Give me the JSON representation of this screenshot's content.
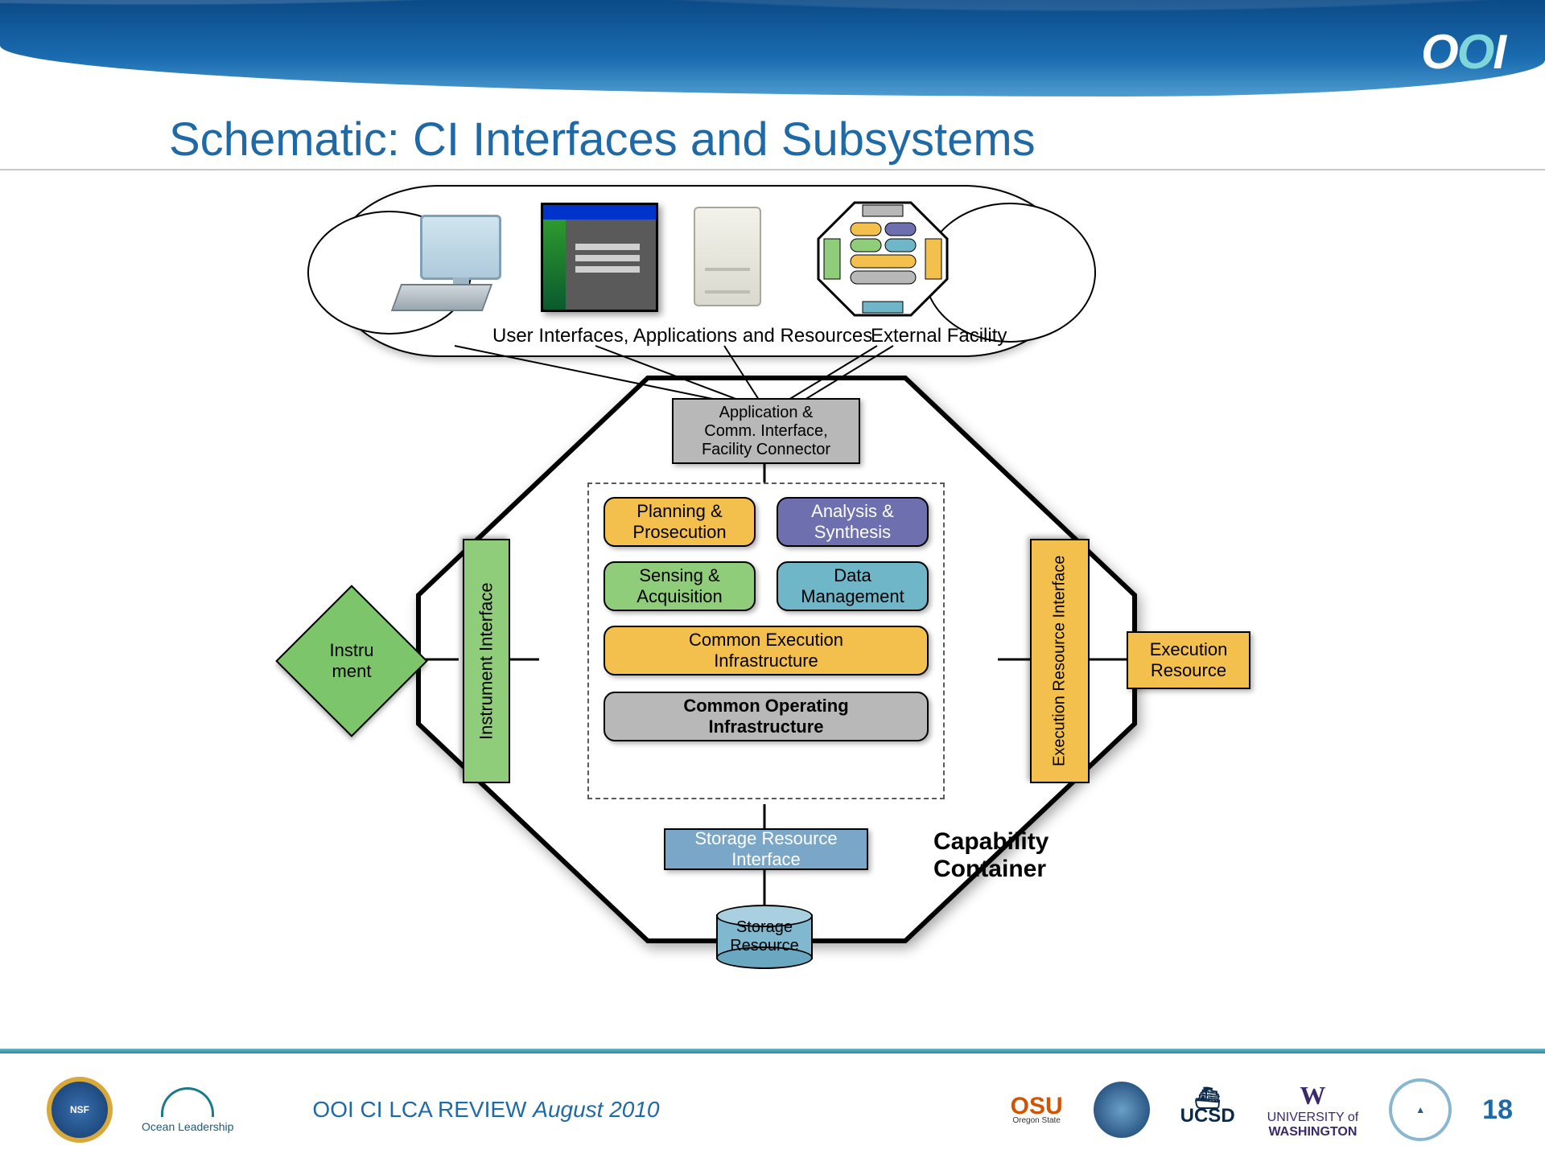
{
  "header": {
    "logo": "OOI"
  },
  "title": "Schematic: CI Interfaces and Subsystems",
  "cloud": {
    "caption_left": "User Interfaces, Applications and Resources",
    "caption_right": "External Facility"
  },
  "blocks": {
    "app_interface": "Application &\nComm. Interface,\nFacility Connector",
    "planning": "Planning &\nProsecution",
    "analysis": "Analysis &\nSynthesis",
    "sensing": "Sensing &\nAcquisition",
    "data_mgmt": "Data\nManagement",
    "cei": "Common Execution\nInfrastructure",
    "coi": "Common Operating\nInfrastructure",
    "instrument_iface": "Instrument\nInterface",
    "exec_iface": "Execution\nResource\nInterface",
    "storage_iface": "Storage Resource\nInterface",
    "instrument": "Instru\nment",
    "exec_resource": "Execution\nResource",
    "storage_resource": "Storage\nResource",
    "capability": "Capability\nContainer"
  },
  "footer": {
    "review": "OOI CI LCA REVIEW ",
    "review_date": "August 2010",
    "page": "18",
    "osu": "OSU",
    "osu_sub": "Oregon State",
    "ucsd": "UCSD",
    "uw_line1": "UNIVERSITY of",
    "uw_line2": "WASHINGTON",
    "ocean": "Ocean Leadership"
  }
}
